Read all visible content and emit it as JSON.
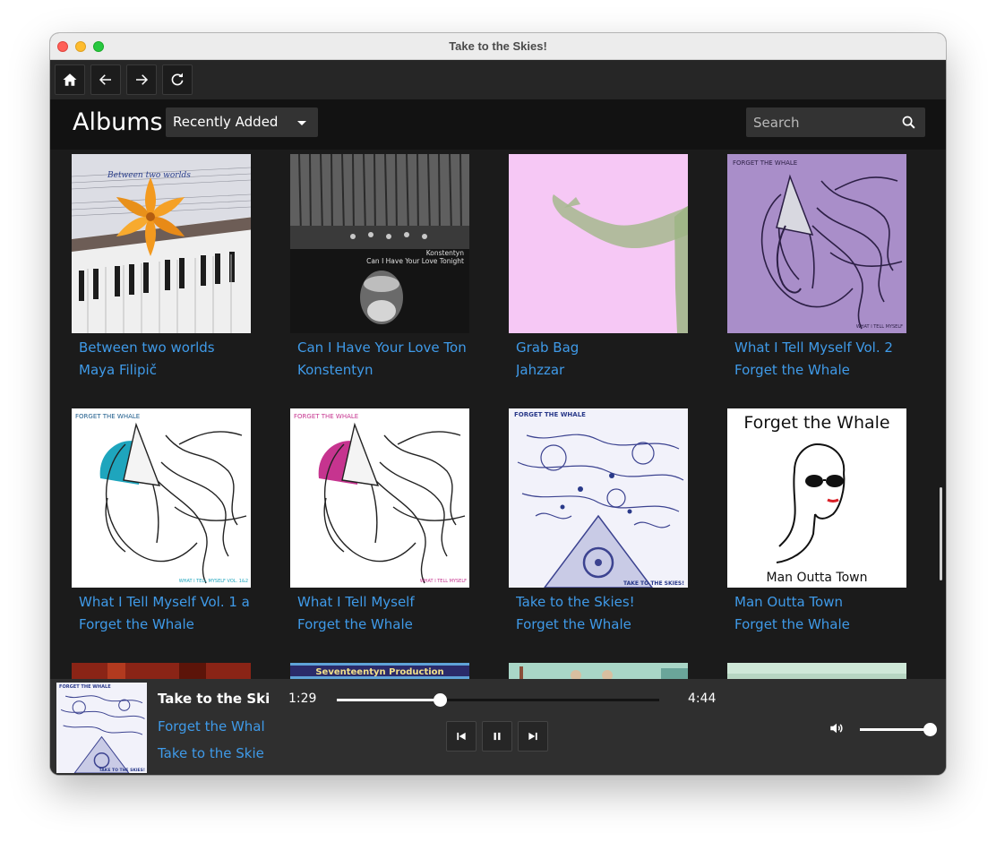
{
  "window": {
    "title": "Take to the Skies!"
  },
  "header": {
    "title": "Albums",
    "sort_selected": "Recently Added",
    "search_placeholder": "Search"
  },
  "albums": [
    {
      "title": "Between two worlds",
      "artist": "Maya Filipič",
      "cover_text": "Between two worlds"
    },
    {
      "title": "Can I Have Your Love Ton",
      "artist": "Konstentyn",
      "cover_text": "Konstentyn",
      "cover_subtext": "Can I Have Your Love Tonight"
    },
    {
      "title": "Grab Bag",
      "artist": "Jahzzar"
    },
    {
      "title": "What I Tell Myself Vol. 2",
      "artist": "Forget the Whale",
      "cover_text": "FORGET THE WHALE",
      "cover_subtext": "WHAT I TELL MYSELF"
    },
    {
      "title": "What I Tell Myself Vol. 1 a",
      "artist": "Forget the Whale",
      "cover_text": "FORGET THE WHALE",
      "cover_subtext": "WHAT I TELL MYSELF VOL. 1&2"
    },
    {
      "title": "What I Tell Myself",
      "artist": "Forget the Whale",
      "cover_text": "FORGET THE WHALE",
      "cover_subtext": "WHAT I TELL MYSELF"
    },
    {
      "title": "Take to the Skies!",
      "artist": "Forget the Whale",
      "cover_text": "FORGET THE WHALE",
      "cover_subtext": "TAKE TO THE SKIES!"
    },
    {
      "title": "Man Outta Town",
      "artist": "Forget the Whale",
      "cover_text": "Forget the Whale",
      "cover_subtext": "Man Outta Town"
    }
  ],
  "partial_row": {
    "cover_text": "Seventeentyn Production"
  },
  "player": {
    "title": "Take to the Ski",
    "artist": "Forget the Whal",
    "album": "Take to the Skie",
    "cover_text": "FORGET THE WHALE",
    "cover_subtext": "TAKE TO THE SKIES!",
    "elapsed": "1:29",
    "duration": "4:44",
    "progress": 0.32,
    "volume": 1.0
  },
  "icons": {
    "home": "home-icon",
    "back": "arrow-left-icon",
    "forward": "arrow-right-icon",
    "reload": "refresh-icon",
    "search": "search-icon",
    "prev": "skip-previous-icon",
    "pause": "pause-icon",
    "next": "skip-next-icon",
    "volume": "volume-icon"
  },
  "colors": {
    "link": "#3f9ae8",
    "background": "#1b1b1b",
    "player": "#2f2f2f"
  }
}
